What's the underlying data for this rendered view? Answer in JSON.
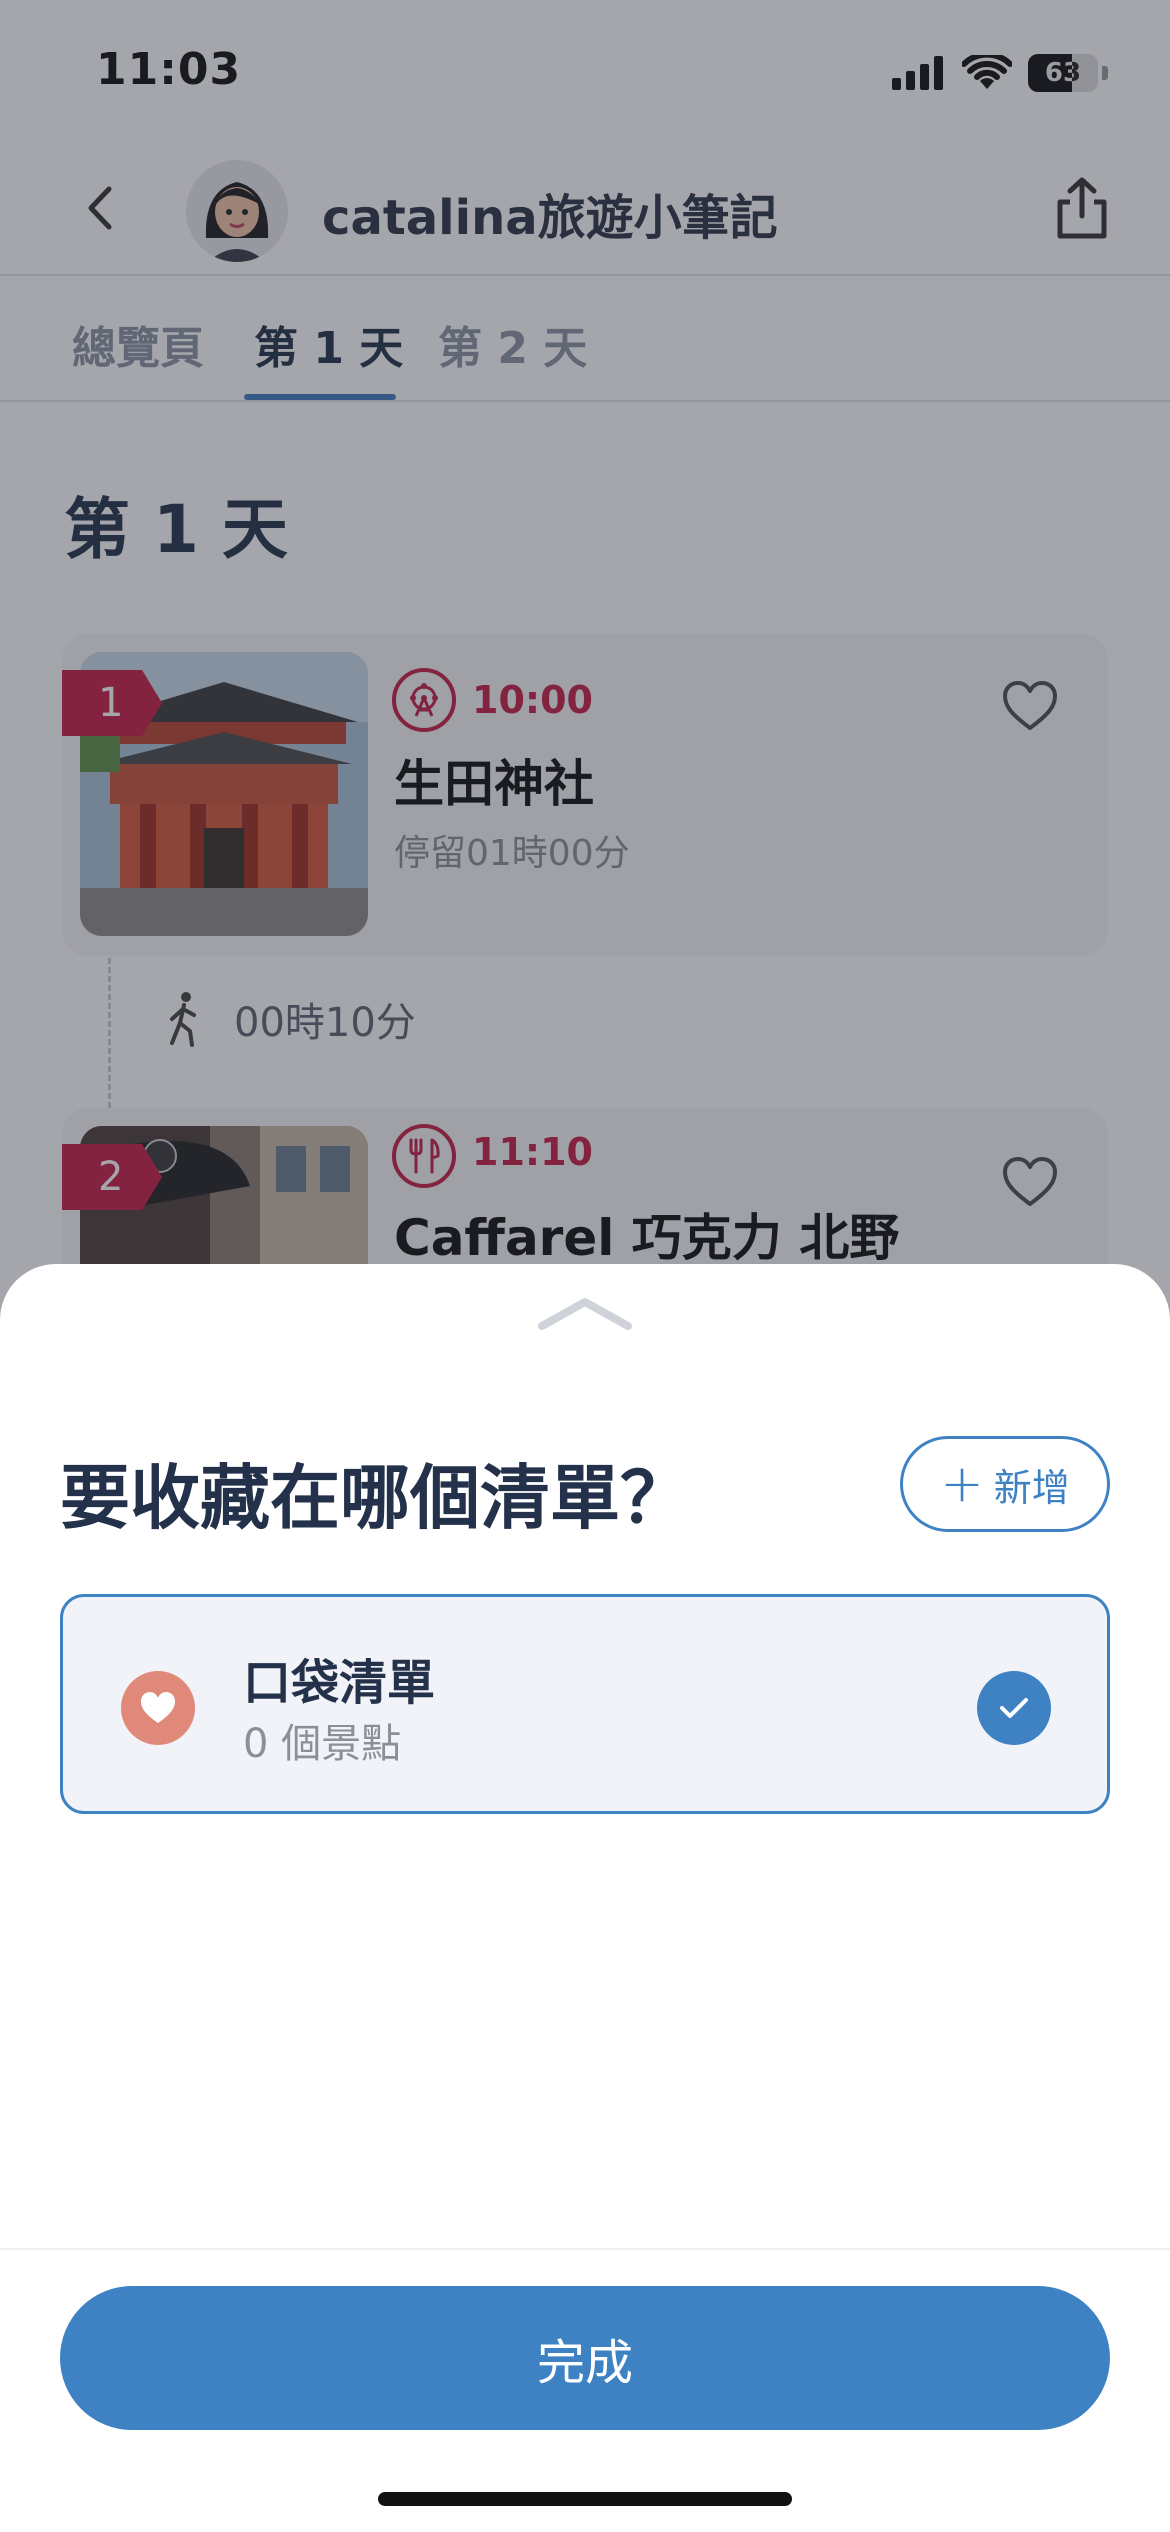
{
  "status_bar": {
    "time": "11:03",
    "battery_text": "63",
    "battery_level": 0.63
  },
  "header": {
    "title": "catalina旅遊小筆記",
    "icons": [
      "back-icon",
      "avatar",
      "share-icon"
    ]
  },
  "tabs": [
    {
      "label": "總覽頁",
      "active": false
    },
    {
      "label": "第 1 天",
      "active": true
    },
    {
      "label": "第 2 天",
      "active": false
    }
  ],
  "day_title": "第 1 天",
  "stops": [
    {
      "number": "1",
      "category_icon": "ferris-wheel-icon",
      "time": "10:00",
      "name": "生田神社",
      "stay": "停留01時00分"
    },
    {
      "number": "2",
      "category_icon": "utensils-icon",
      "time": "11:10",
      "name": "Caffarel 巧克力 北野"
    }
  ],
  "travel": {
    "icon": "walking-icon",
    "duration": "00時10分"
  },
  "sheet": {
    "title": "要收藏在哪個清單？",
    "add_button": {
      "plus": "+",
      "label": "新增"
    },
    "lists": [
      {
        "name": "口袋清單",
        "count": "0 個景點",
        "selected": true
      }
    ],
    "done_label": "完成"
  },
  "colors": {
    "accent_blue": "#3e82c4",
    "category_red": "#c41e45",
    "heart_salmon": "#e0897a",
    "title_navy": "#23324a"
  }
}
